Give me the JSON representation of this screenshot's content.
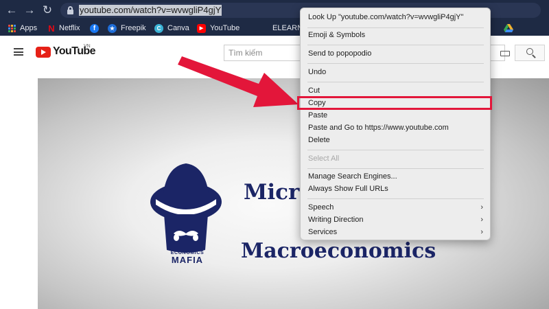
{
  "browser": {
    "nav": {
      "back": "←",
      "forward": "→",
      "reload": "↻"
    },
    "url": "youtube.com/watch?v=wvwgliP4gjY",
    "bookmarks": [
      {
        "label": "Apps",
        "icon": "apps-grid-icon"
      },
      {
        "label": "Netflix",
        "icon": "netflix-icon",
        "glyph": "N"
      },
      {
        "label": "",
        "icon": "facebook-icon",
        "glyph": "f"
      },
      {
        "label": "Freepik",
        "icon": "freepik-icon",
        "glyph": "★"
      },
      {
        "label": "Canva",
        "icon": "canva-icon",
        "glyph": "C"
      },
      {
        "label": "YouTube",
        "icon": "youtube-icon",
        "glyph": "▶"
      },
      {
        "label": "ELEARNI",
        "icon": ""
      },
      {
        "label": "",
        "icon": "google-drive-icon"
      }
    ]
  },
  "youtube": {
    "brand": "YouTube",
    "country": "VN",
    "search_placeholder": "Tìm kiếm"
  },
  "video": {
    "title_line1": "Micro",
    "title_line2": "Macroeconomics",
    "logo_top": "ECONOMICS",
    "logo_bottom": "MAFIA"
  },
  "context_menu": {
    "items": [
      {
        "label": "Look Up \"youtube.com/watch?v=wvwgliP4gjY\"",
        "enabled": true
      },
      {
        "label": "Emoji & Symbols",
        "enabled": true
      },
      {
        "label": "Send to popopodio",
        "enabled": true
      },
      {
        "label": "Undo",
        "enabled": true
      },
      {
        "label": "Cut",
        "enabled": true
      },
      {
        "label": "Copy",
        "enabled": true,
        "highlighted": true
      },
      {
        "label": "Paste",
        "enabled": true
      },
      {
        "label": "Paste and Go to https://www.youtube.com",
        "enabled": true
      },
      {
        "label": "Delete",
        "enabled": true
      },
      {
        "label": "Select All",
        "enabled": false
      },
      {
        "label": "Manage Search Engines...",
        "enabled": true
      },
      {
        "label": "Always Show Full URLs",
        "enabled": true
      },
      {
        "label": "Speech",
        "enabled": true,
        "submenu": true
      },
      {
        "label": "Writing Direction",
        "enabled": true,
        "submenu": true
      },
      {
        "label": "Services",
        "enabled": true,
        "submenu": true
      }
    ],
    "submenu_glyph": "›"
  },
  "colors": {
    "annotation_red": "#e3163a",
    "chrome_bg": "#1e2a44",
    "title_navy": "#1b2566",
    "youtube_red": "#e62117"
  }
}
